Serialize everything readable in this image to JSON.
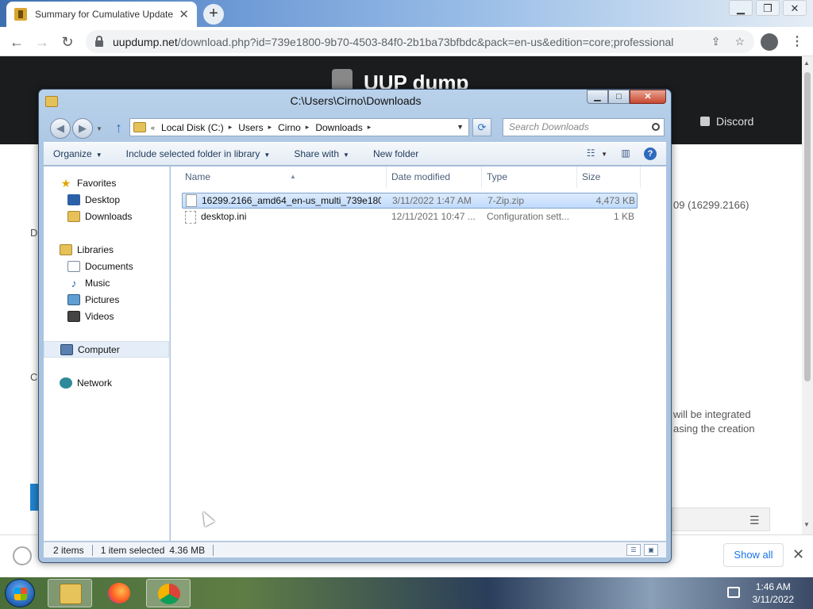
{
  "browser": {
    "tab_title": "Summary for Cumulative Update",
    "url_host": "uupdump.net",
    "url_path": "/download.php?id=739e1800-9b70-4503-84f0-2b1ba73bfbdc&pack=en-us&edition=core;professional"
  },
  "website": {
    "logo_text": "UUP dump",
    "discord_label": "Discord",
    "build_fragment": "09 (16299.2166)",
    "note_line1": "will be integrated",
    "note_line2": "asing the creation",
    "side_letter_d": "D",
    "side_letter_c": "C"
  },
  "download_bar": {
    "show_all_label": "Show all"
  },
  "explorer": {
    "title": "C:\\Users\\Cirno\\Downloads",
    "breadcrumbs": [
      "Local Disk (C:)",
      "Users",
      "Cirno",
      "Downloads"
    ],
    "search_placeholder": "Search Downloads",
    "commands": {
      "organize": "Organize",
      "include": "Include selected folder in library",
      "share": "Share with",
      "new_folder": "New folder"
    },
    "nav": {
      "favorites": "Favorites",
      "desktop": "Desktop",
      "downloads": "Downloads",
      "libraries": "Libraries",
      "documents": "Documents",
      "music": "Music",
      "pictures": "Pictures",
      "videos": "Videos",
      "computer": "Computer",
      "network": "Network"
    },
    "columns": {
      "name": "Name",
      "date": "Date modified",
      "type": "Type",
      "size": "Size"
    },
    "files": [
      {
        "name": "16299.2166_amd64_en-us_multi_739e180...",
        "date": "3/11/2022 1:47 AM",
        "type": "7-Zip.zip",
        "size": "4,473 KB"
      },
      {
        "name": "desktop.ini",
        "date": "12/11/2021 10:47 ...",
        "type": "Configuration sett...",
        "size": "1 KB"
      }
    ],
    "status": {
      "items": "2 items",
      "selected": "1 item selected",
      "size": "4.36 MB"
    }
  },
  "taskbar": {
    "time": "1:46 AM",
    "date": "3/11/2022"
  },
  "colors": {
    "explorer_frame": "#aac3df",
    "selection": "#c1dbfc",
    "chrome_link": "#1a73e8"
  }
}
